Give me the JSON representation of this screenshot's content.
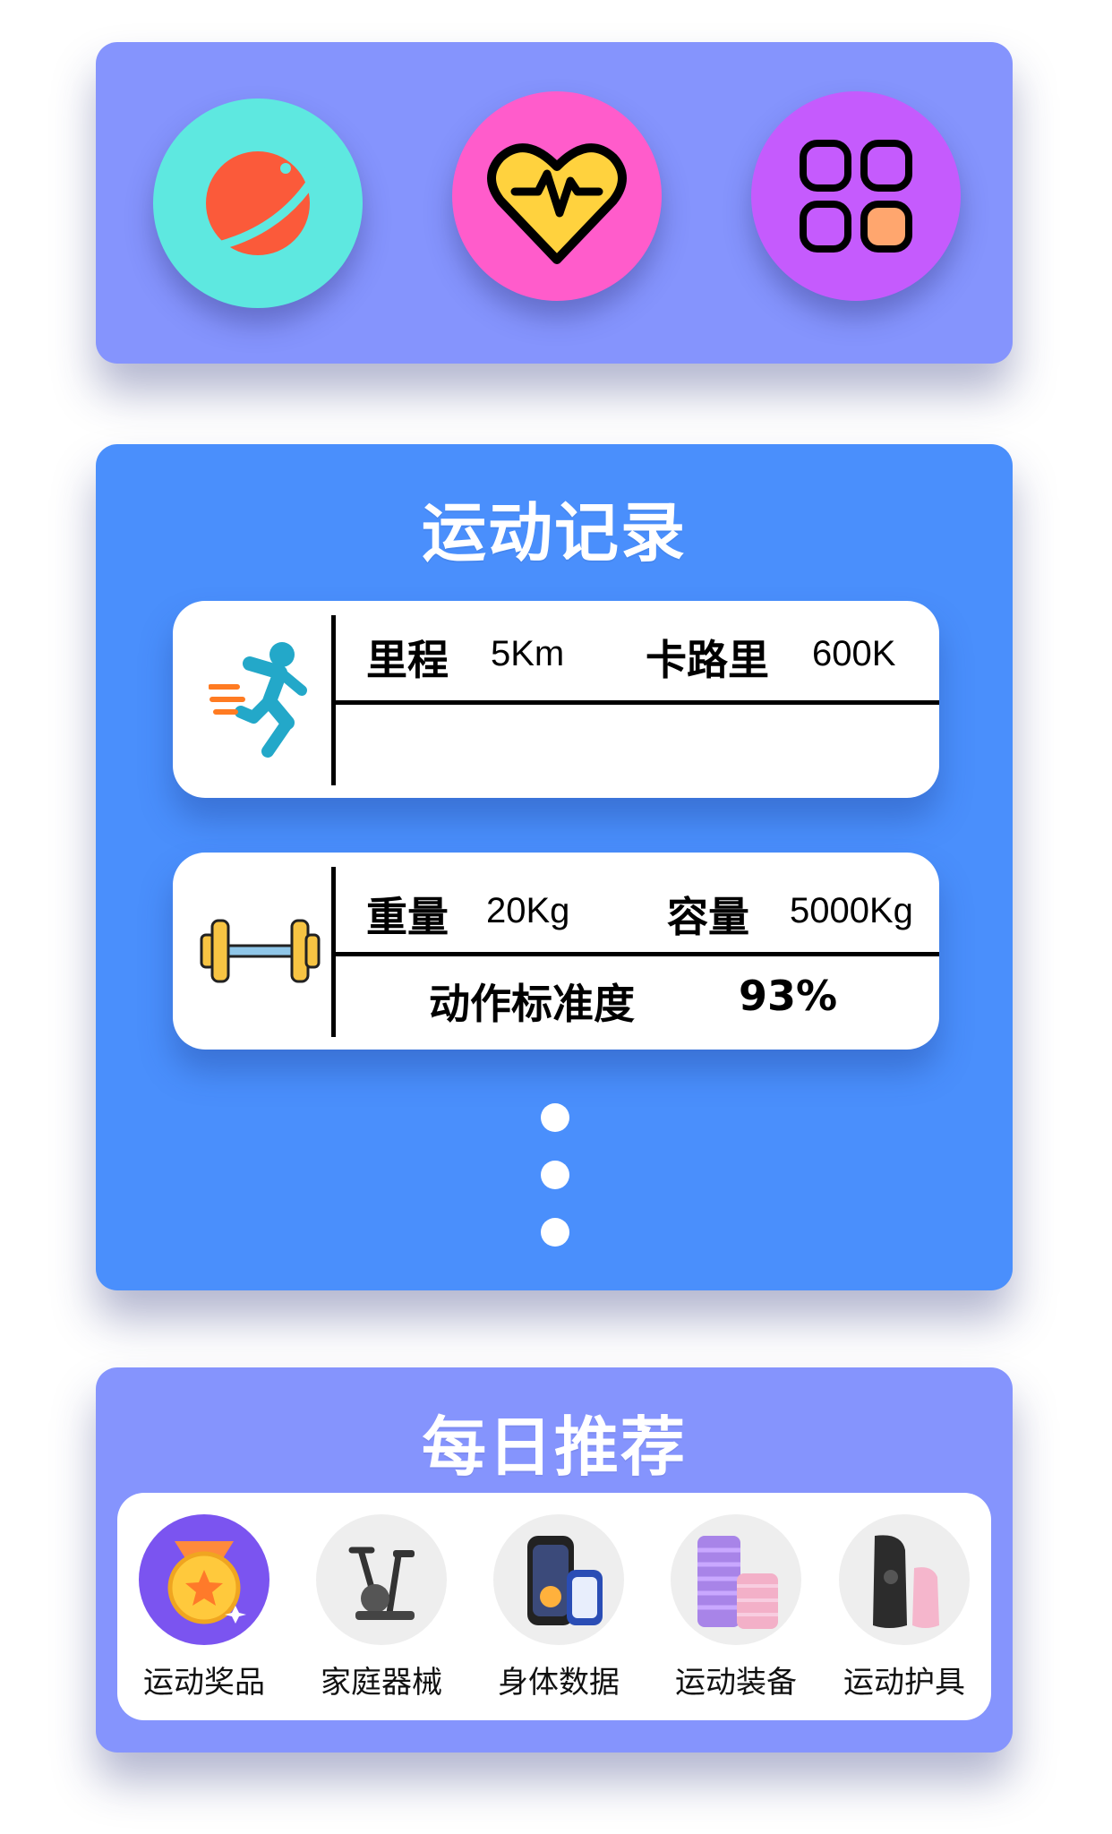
{
  "colors": {
    "top_card": "#8594fd",
    "record_card": "#4a8ffc",
    "recommend_card": "#8594fd",
    "planet_circle": "#5ee8e0",
    "heart_circle": "#ff5ccb",
    "apps_circle": "#c55bfd"
  },
  "top_icons": [
    {
      "icon": "planet-icon"
    },
    {
      "icon": "heart-pulse-icon"
    },
    {
      "icon": "apps-grid-icon"
    }
  ],
  "record": {
    "title": "运动记录",
    "run": {
      "icon": "running-person-icon",
      "distance_label": "里程",
      "distance_value": "5Km",
      "calories_label": "卡路里",
      "calories_value": "600K"
    },
    "lift": {
      "icon": "dumbbell-icon",
      "weight_label": "重量",
      "weight_value": "20Kg",
      "volume_label": "容量",
      "volume_value": "5000Kg",
      "accuracy_label": "动作标准度",
      "accuracy_value": "93%"
    }
  },
  "recommend": {
    "title": "每日推荐",
    "items": [
      {
        "label": "运动奖品",
        "icon": "medal-icon"
      },
      {
        "label": "家庭器械",
        "icon": "exercise-bike-icon"
      },
      {
        "label": "身体数据",
        "icon": "smartwatch-icon"
      },
      {
        "label": "运动装备",
        "icon": "foam-roller-icon"
      },
      {
        "label": "运动护具",
        "icon": "knee-brace-icon"
      }
    ]
  }
}
